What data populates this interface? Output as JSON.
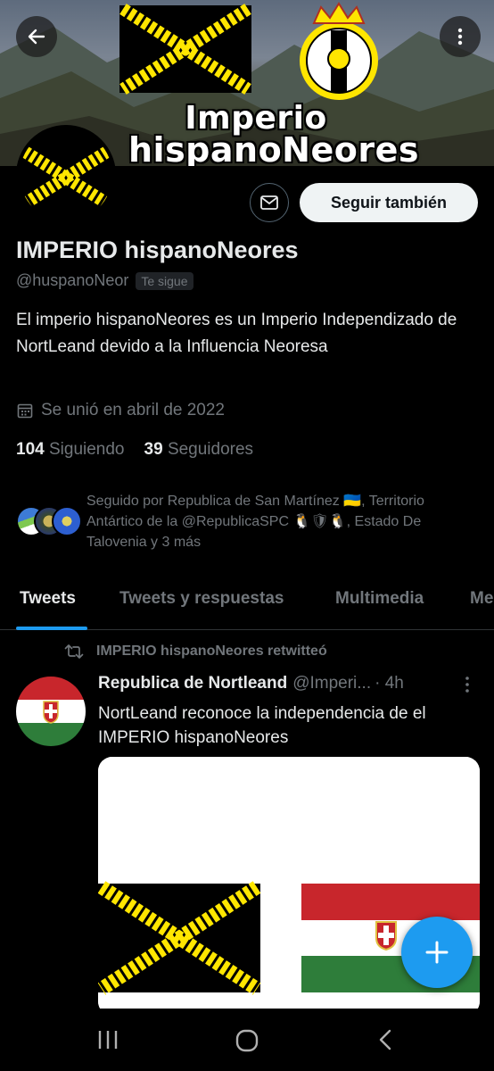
{
  "banner": {
    "title_line1": "Imperio",
    "title_line2": "hispanoNeores"
  },
  "profile": {
    "display_name": "IMPERIO hispanoNeores",
    "handle": "@huspanoNeor",
    "follows_you": "Te sigue",
    "bio": "El imperio hispanoNeores es un Imperio Independizado de NortLeand devido a la Influencia Neoresa",
    "joined": "Se unió en abril de 2022",
    "following_count": "104",
    "following_label": "Siguiendo",
    "followers_count": "39",
    "followers_label": "Seguidores",
    "followed_by": "Seguido por Republica de San Martínez 🇺🇦, Territorio Antártico de la @RepublicaSPC 🐧🛡🐧, Estado De Talovenia y 3 más"
  },
  "actions": {
    "follow_label": "Seguir también"
  },
  "tabs": [
    {
      "label": "Tweets"
    },
    {
      "label": "Tweets y respuestas"
    },
    {
      "label": "Multimedia"
    },
    {
      "label": "Me"
    }
  ],
  "tweet": {
    "retweet_label": "IMPERIO hispanoNeores retwitteó",
    "author_name": "Republica de Nortleand",
    "author_handle": "@Imperi...",
    "time": "· 4h",
    "text": "NortLeand reconoce la independencia de el IMPERIO hispanoNeores"
  },
  "colors": {
    "accent": "#1d9bf0",
    "flag_yellow": "#ffe600",
    "background": "#000000"
  },
  "icons": [
    "back-arrow-icon",
    "more-vertical-icon",
    "mail-icon",
    "calendar-icon",
    "retweet-icon",
    "plus-icon"
  ]
}
